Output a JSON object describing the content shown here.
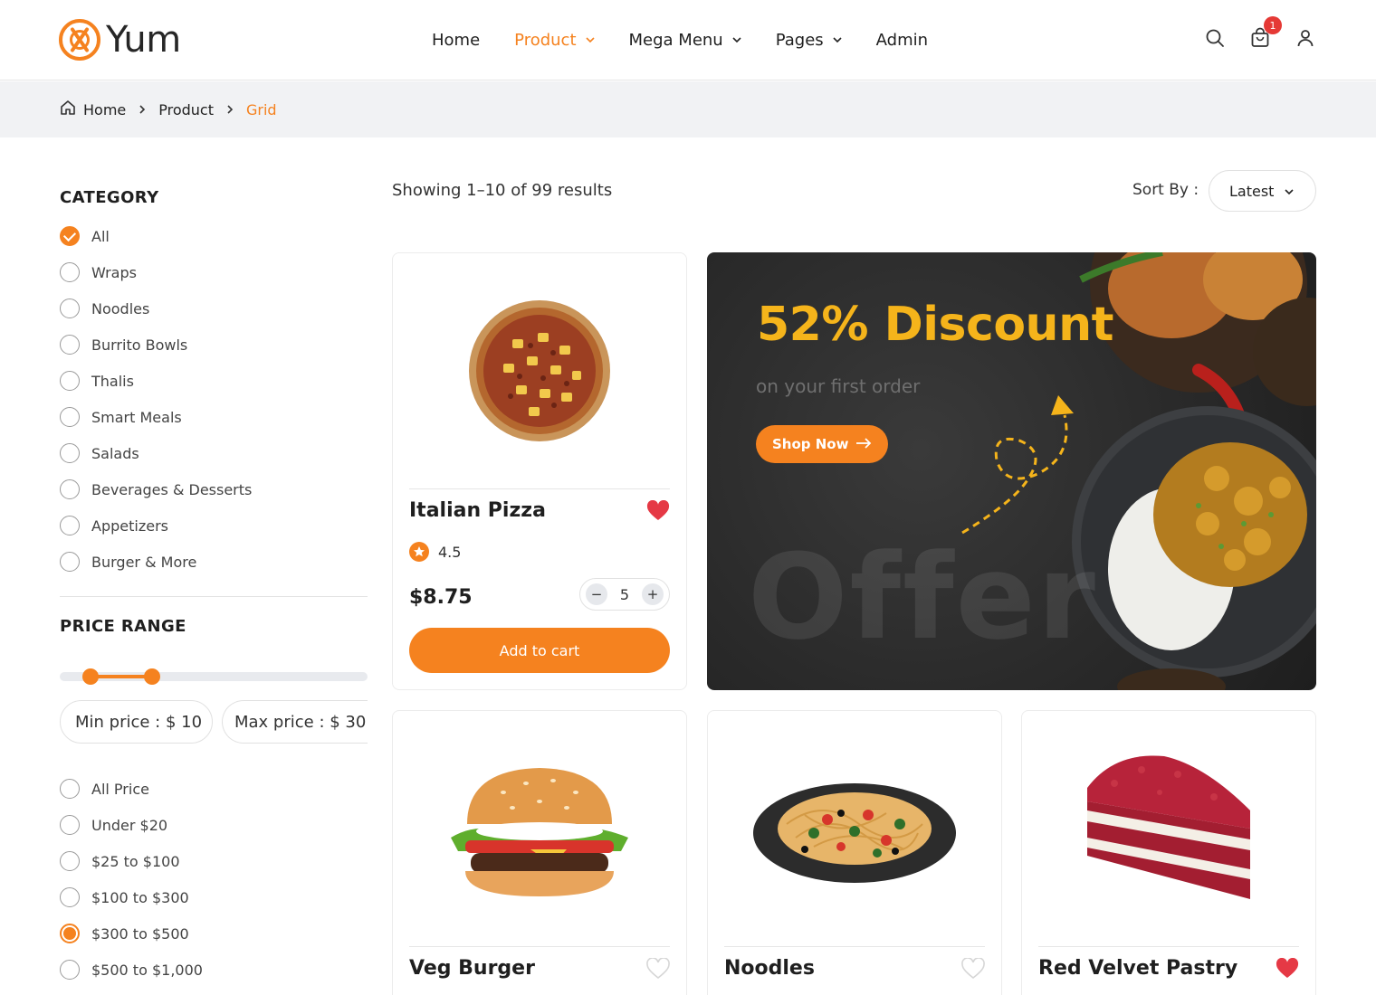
{
  "brand": {
    "name": "Yum",
    "accent": "#f5821f"
  },
  "nav": {
    "items": [
      {
        "label": "Home",
        "dropdown": false,
        "active": false
      },
      {
        "label": "Product",
        "dropdown": true,
        "active": true
      },
      {
        "label": "Mega Menu",
        "dropdown": true,
        "active": false
      },
      {
        "label": "Pages",
        "dropdown": true,
        "active": false
      },
      {
        "label": "Admin",
        "dropdown": false,
        "active": false
      }
    ]
  },
  "header_icons": {
    "search": "search-icon",
    "cart": "shopping-bag-icon",
    "cart_count": "1",
    "user": "user-icon"
  },
  "breadcrumb": {
    "home": "Home",
    "product": "Product",
    "current": "Grid"
  },
  "sidebar": {
    "category_title": "CATEGORY",
    "categories": [
      {
        "label": "All",
        "checked": true
      },
      {
        "label": "Wraps",
        "checked": false
      },
      {
        "label": "Noodles",
        "checked": false
      },
      {
        "label": "Burrito Bowls",
        "checked": false
      },
      {
        "label": "Thalis",
        "checked": false
      },
      {
        "label": "Smart Meals",
        "checked": false
      },
      {
        "label": "Salads",
        "checked": false
      },
      {
        "label": "Beverages & Desserts",
        "checked": false
      },
      {
        "label": "Appetizers",
        "checked": false
      },
      {
        "label": "Burger & More",
        "checked": false
      }
    ],
    "price_title": "PRICE RANGE",
    "min_price": "Min price : $ 10",
    "max_price": "Max price : $ 30",
    "price_options": [
      {
        "label": "All Price",
        "checked": false
      },
      {
        "label": "Under $20",
        "checked": false
      },
      {
        "label": "$25 to $100",
        "checked": false
      },
      {
        "label": "$100 to $300",
        "checked": false
      },
      {
        "label": "$300 to $500",
        "checked": true
      },
      {
        "label": "$500 to $1,000",
        "checked": false
      }
    ]
  },
  "toolbar": {
    "showing": "Showing 1–10 of 99 results",
    "sort_label": "Sort By :",
    "sort_value": "Latest"
  },
  "products": [
    {
      "name": "Italian Pizza",
      "rating": "4.5",
      "price": "$8.75",
      "qty": "5",
      "favorite": true,
      "add_label": "Add to cart"
    },
    {
      "name": "Veg Burger",
      "favorite": false
    },
    {
      "name": "Noodles",
      "favorite": false
    },
    {
      "name": "Red Velvet Pastry",
      "favorite": true
    }
  ],
  "banner": {
    "title": "52% Discount",
    "subtitle": "on your first order",
    "button": "Shop Now",
    "watermark": "Offer"
  }
}
